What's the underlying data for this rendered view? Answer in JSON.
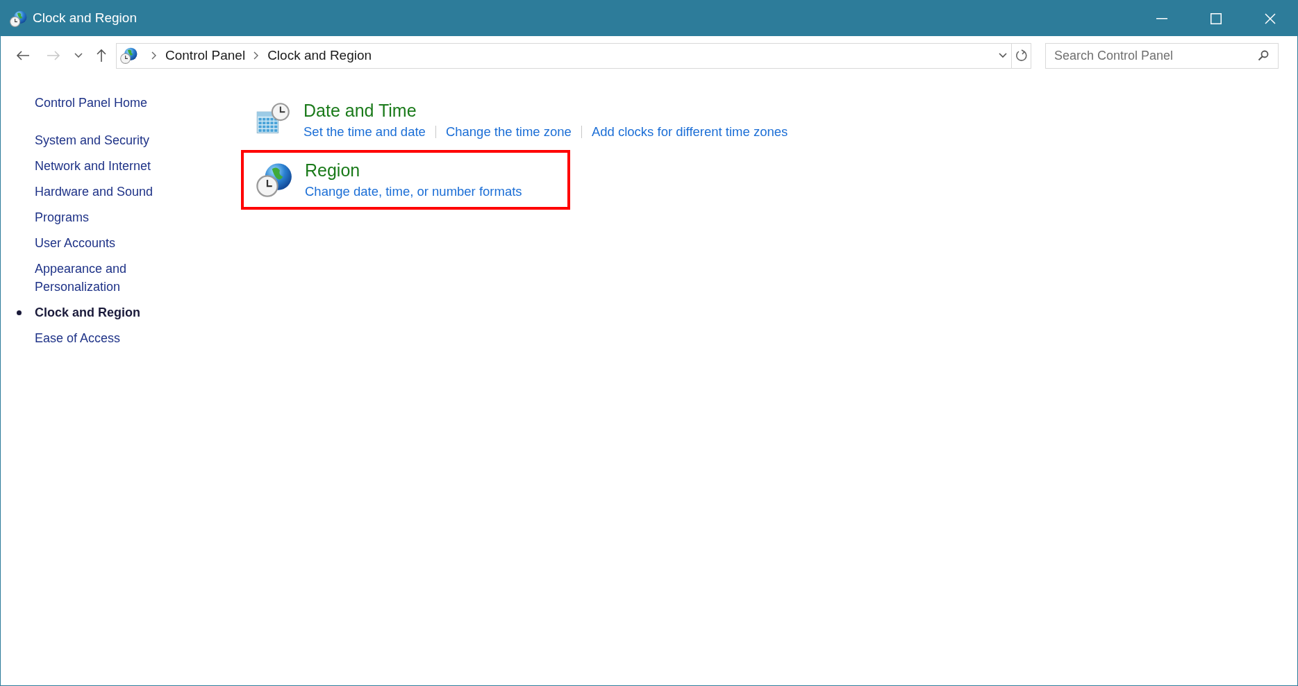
{
  "window": {
    "title": "Clock and Region"
  },
  "address_bar": {
    "breadcrumbs": [
      "Control Panel",
      "Clock and Region"
    ]
  },
  "search": {
    "placeholder": "Search Control Panel"
  },
  "sidebar": {
    "items": [
      {
        "label": "Control Panel Home",
        "selected": false
      },
      {
        "label": "System and Security",
        "selected": false
      },
      {
        "label": "Network and Internet",
        "selected": false
      },
      {
        "label": "Hardware and Sound",
        "selected": false
      },
      {
        "label": "Programs",
        "selected": false
      },
      {
        "label": "User Accounts",
        "selected": false
      },
      {
        "label": "Appearance and Personalization",
        "selected": false
      },
      {
        "label": "Clock and Region",
        "selected": true
      },
      {
        "label": "Ease of Access",
        "selected": false
      }
    ]
  },
  "categories": [
    {
      "kind": "datetime",
      "title": "Date and Time",
      "highlighted": false,
      "links": [
        "Set the time and date",
        "Change the time zone",
        "Add clocks for different time zones"
      ]
    },
    {
      "kind": "region",
      "title": "Region",
      "highlighted": true,
      "links": [
        "Change date, time, or number formats"
      ]
    }
  ]
}
